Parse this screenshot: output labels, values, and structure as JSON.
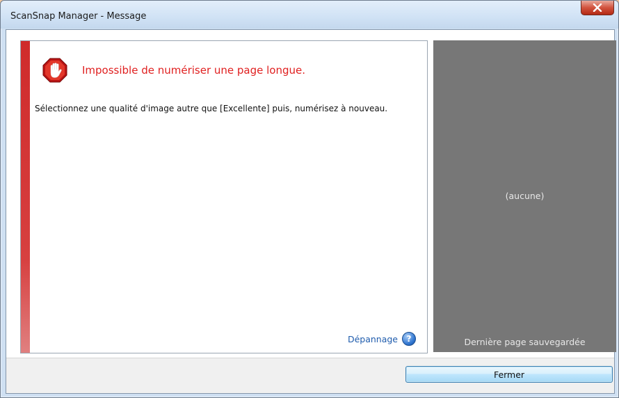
{
  "window": {
    "title": "ScanSnap Manager - Message",
    "close_glyph": "x"
  },
  "message": {
    "icon": "stop-hand-icon",
    "title": "Impossible de numériser une page longue.",
    "body": "Sélectionnez une qualité d'image autre que [Excellente] puis, numérisez à nouveau.",
    "help_link": "Dépannage",
    "help_icon_glyph": "?"
  },
  "preview": {
    "placeholder": "(aucune)",
    "caption": "Dernière page sauvegardée"
  },
  "footer": {
    "close_button": "Fermer"
  },
  "colors": {
    "alert_red": "#e02020",
    "link_blue": "#1f5cad",
    "preview_gray": "#777777"
  }
}
